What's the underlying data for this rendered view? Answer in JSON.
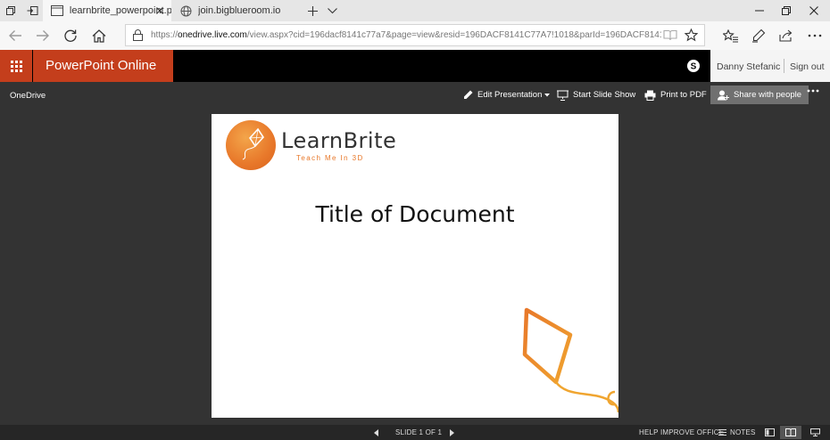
{
  "browser": {
    "tabs": [
      {
        "title": "learnbrite_powerpoint.p",
        "active": true
      },
      {
        "title": "join.bigblueroom.io",
        "active": false
      }
    ],
    "url": {
      "scheme": "https://",
      "host": "onedrive.live.com",
      "path": "/view.aspx?cid=196dacf8141c77a7&page=view&resid=196DACF8141C77A7!1018&parId=196DACF8141C77A7!"
    }
  },
  "app": {
    "name": "PowerPoint Online",
    "user_name": "Danny Stefanic",
    "sign_out": "Sign out"
  },
  "command_bar": {
    "breadcrumb": "OneDrive",
    "edit": "Edit Presentation",
    "slideshow": "Start Slide Show",
    "print": "Print to PDF",
    "share": "Share with people"
  },
  "slide": {
    "logo_word": "LearnBrite",
    "logo_tagline": "Teach Me In 3D",
    "title": "Title of Document"
  },
  "status_bar": {
    "slide_indicator": "SLIDE 1 OF 1",
    "help": "HELP IMPROVE OFFICE",
    "notes": "NOTES"
  },
  "colors": {
    "office_accent": "#c43e1c",
    "logo_orange": "#e8782a",
    "canvas_bg": "#333333"
  },
  "icons": [
    "tab-actions-icon",
    "set-aside-icon",
    "page-icon",
    "globe-icon",
    "close-icon",
    "new-tab-icon",
    "chevron-down-icon",
    "minimize-icon",
    "maximize-icon",
    "window-close-icon",
    "back-arrow-icon",
    "forward-arrow-icon",
    "refresh-icon",
    "home-icon",
    "lock-icon",
    "reading-view-icon",
    "star-icon",
    "favorites-icon",
    "pen-icon",
    "share-icon",
    "more-icon",
    "waffle-icon",
    "skype-icon",
    "pencil-icon",
    "slideshow-icon",
    "printer-icon",
    "person-add-icon",
    "prev-slide-icon",
    "next-slide-icon",
    "notes-icon",
    "normal-view-icon",
    "reading-view-icon",
    "slideshow-view-icon"
  ]
}
